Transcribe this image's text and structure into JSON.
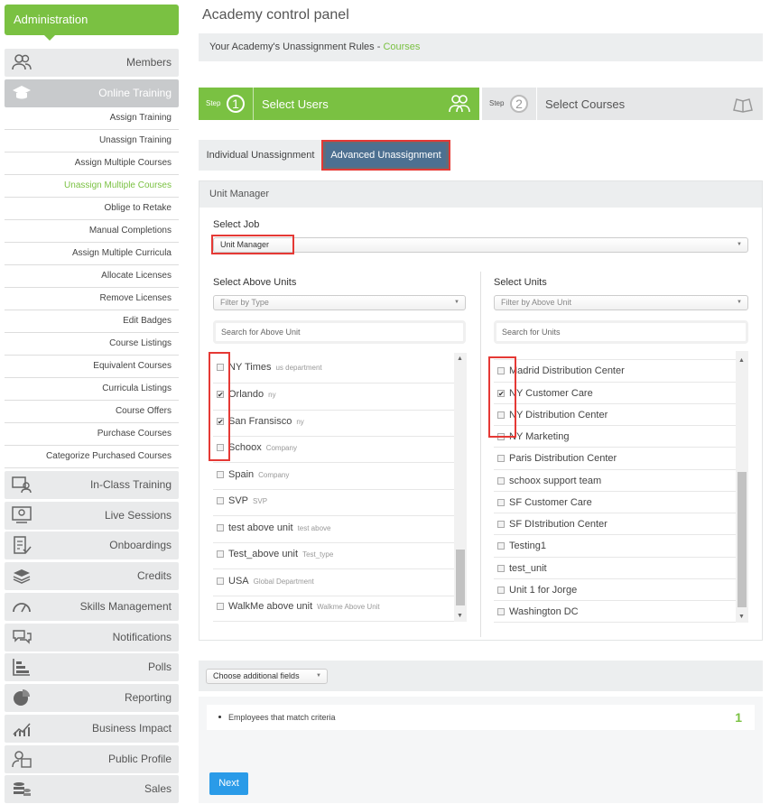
{
  "sidebar": {
    "admin_label": "Administration",
    "items_top": [
      {
        "label": "Members",
        "icon": "members-icon"
      },
      {
        "label": "Online Training",
        "icon": "graduation-cap-icon"
      }
    ],
    "subitems": [
      {
        "label": "Assign Training"
      },
      {
        "label": "Unassign Training"
      },
      {
        "label": "Assign Multiple Courses"
      },
      {
        "label": "Unassign Multiple Courses"
      },
      {
        "label": "Oblige to Retake"
      },
      {
        "label": "Manual Completions"
      },
      {
        "label": "Assign Multiple Curricula"
      },
      {
        "label": "Allocate Licenses"
      },
      {
        "label": "Remove Licenses"
      },
      {
        "label": "Edit Badges"
      },
      {
        "label": "Course Listings"
      },
      {
        "label": "Equivalent Courses"
      },
      {
        "label": "Curricula Listings"
      },
      {
        "label": "Course Offers"
      },
      {
        "label": "Purchase Courses"
      },
      {
        "label": "Categorize Purchased Courses"
      }
    ],
    "items_bottom": [
      {
        "label": "In-Class Training",
        "icon": "in-class-icon"
      },
      {
        "label": "Live Sessions",
        "icon": "live-sessions-icon"
      },
      {
        "label": "Onboardings",
        "icon": "onboardings-icon"
      },
      {
        "label": "Credits",
        "icon": "credits-icon"
      },
      {
        "label": "Skills Management",
        "icon": "gauge-icon"
      },
      {
        "label": "Notifications",
        "icon": "notifications-icon"
      },
      {
        "label": "Polls",
        "icon": "polls-icon"
      },
      {
        "label": "Reporting",
        "icon": "pie-chart-icon"
      },
      {
        "label": "Business Impact",
        "icon": "business-impact-icon"
      },
      {
        "label": "Public Profile",
        "icon": "public-profile-icon"
      },
      {
        "label": "Sales",
        "icon": "sales-icon"
      }
    ]
  },
  "header": {
    "title": "Academy control panel",
    "rules_prefix": "Your Academy's Unassignment Rules - ",
    "rules_link": "Courses"
  },
  "steps": {
    "step_word": "Step",
    "step1_num": "1",
    "step1_title": "Select Users",
    "step2_num": "2",
    "step2_title": "Select Courses"
  },
  "tabs": {
    "individual": "Individual Unassignment",
    "advanced": "Advanced Unassignment"
  },
  "panel": {
    "heading": "Unit Manager",
    "select_job_label": "Select Job",
    "select_job_value": "Unit Manager",
    "left": {
      "label": "Select Above Units",
      "filter_placeholder": "Filter by Type",
      "search_placeholder": "Search for Above Unit",
      "rows": [
        {
          "name": "NY Times",
          "type": "us department",
          "checked": false
        },
        {
          "name": "Orlando",
          "type": "ny",
          "checked": true
        },
        {
          "name": "San Fransisco",
          "type": "ny",
          "checked": true
        },
        {
          "name": "Schoox",
          "type": "Company",
          "checked": false
        },
        {
          "name": "Spain",
          "type": "Company",
          "checked": false
        },
        {
          "name": "SVP",
          "type": "SVP",
          "checked": false
        },
        {
          "name": "test above unit",
          "type": "test above",
          "checked": false
        },
        {
          "name": "Test_above unit",
          "type": "Test_type",
          "checked": false
        },
        {
          "name": "USA",
          "type": "Global Department",
          "checked": false
        },
        {
          "name": "WalkMe above unit",
          "type": "Walkme Above Unit",
          "checked": false
        }
      ]
    },
    "right": {
      "label": "Select Units",
      "filter_placeholder": "Filter by Above Unit",
      "search_placeholder": "Search for Units",
      "rows": [
        {
          "name": "Madrid Distribution Center",
          "checked": false
        },
        {
          "name": "NY Customer Care",
          "checked": true
        },
        {
          "name": "NY Distribution Center",
          "checked": false
        },
        {
          "name": "NY Marketing",
          "checked": false
        },
        {
          "name": "Paris Distribution Center",
          "checked": false
        },
        {
          "name": "schoox support team",
          "checked": false
        },
        {
          "name": "SF Customer Care",
          "checked": false
        },
        {
          "name": "SF DIstribution Center",
          "checked": false
        },
        {
          "name": "Testing1",
          "checked": false
        },
        {
          "name": "test_unit",
          "checked": false
        },
        {
          "name": "Unit 1 for Jorge",
          "checked": false
        },
        {
          "name": "Washington DC",
          "checked": false
        }
      ]
    }
  },
  "additional": {
    "select_label": "Choose additional fields"
  },
  "criteria": {
    "label": "Employees that match criteria",
    "count": "1",
    "next_label": "Next"
  },
  "colors": {
    "brand_green": "#7ac142",
    "annotation_red": "#e53935",
    "next_blue": "#2a9be8"
  }
}
